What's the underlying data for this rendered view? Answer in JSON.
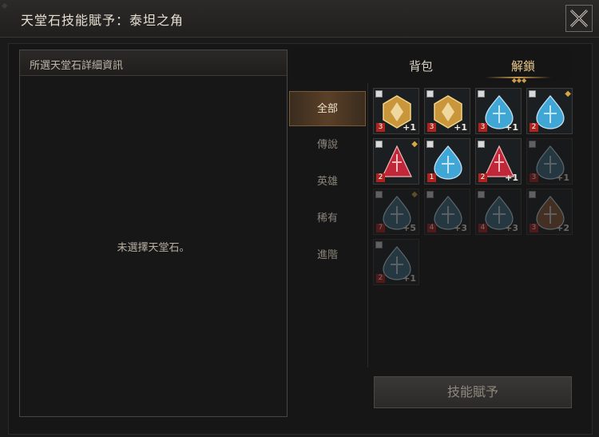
{
  "window": {
    "title": "天堂石技能賦予：泰坦之角"
  },
  "left_panel": {
    "header": "所選天堂石詳細資訊",
    "empty_text": "未選擇天堂石。"
  },
  "tabs": [
    {
      "label": "背包",
      "active": false
    },
    {
      "label": "解鎖",
      "active": true
    }
  ],
  "categories": [
    {
      "label": "全部",
      "active": true
    },
    {
      "label": "傳說",
      "active": false
    },
    {
      "label": "英雄",
      "active": false
    },
    {
      "label": "稀有",
      "active": false
    },
    {
      "label": "進階",
      "active": false
    }
  ],
  "stones": [
    {
      "level": "3",
      "plus": "+1",
      "color": "#c9963c",
      "shape": "hex",
      "dim": false,
      "badge": false
    },
    {
      "level": "3",
      "plus": "+1",
      "color": "#c9963c",
      "shape": "hex",
      "dim": false,
      "badge": false
    },
    {
      "level": "3",
      "plus": "+1",
      "color": "#3fa6d6",
      "shape": "drop",
      "dim": false,
      "badge": false
    },
    {
      "level": "2",
      "plus": "",
      "color": "#3fa6d6",
      "shape": "drop",
      "dim": false,
      "badge": true
    },
    {
      "level": "2",
      "plus": "",
      "color": "#c0283a",
      "shape": "tri",
      "dim": false,
      "badge": true
    },
    {
      "level": "1",
      "plus": "",
      "color": "#3fa6d6",
      "shape": "drop",
      "dim": false,
      "badge": false
    },
    {
      "level": "2",
      "plus": "+1",
      "color": "#c0283a",
      "shape": "tri",
      "dim": false,
      "badge": false
    },
    {
      "level": "3",
      "plus": "+1",
      "color": "#3d6e86",
      "shape": "drop",
      "dim": true,
      "badge": false
    },
    {
      "level": "7",
      "plus": "+5",
      "color": "#3d6e86",
      "shape": "drop",
      "dim": true,
      "badge": true
    },
    {
      "level": "4",
      "plus": "+3",
      "color": "#3d6e86",
      "shape": "drop",
      "dim": true,
      "badge": false
    },
    {
      "level": "4",
      "plus": "+3",
      "color": "#3d6e86",
      "shape": "drop",
      "dim": true,
      "badge": false
    },
    {
      "level": "3",
      "plus": "+2",
      "color": "#8a5a3a",
      "shape": "drop",
      "dim": true,
      "badge": false
    },
    {
      "level": "2",
      "plus": "+1",
      "color": "#3d6e86",
      "shape": "drop",
      "dim": true,
      "badge": false
    }
  ],
  "assign_button": "技能賦予",
  "icons": {
    "close": "close-x-icon",
    "badge": "diamond-badge-icon"
  }
}
